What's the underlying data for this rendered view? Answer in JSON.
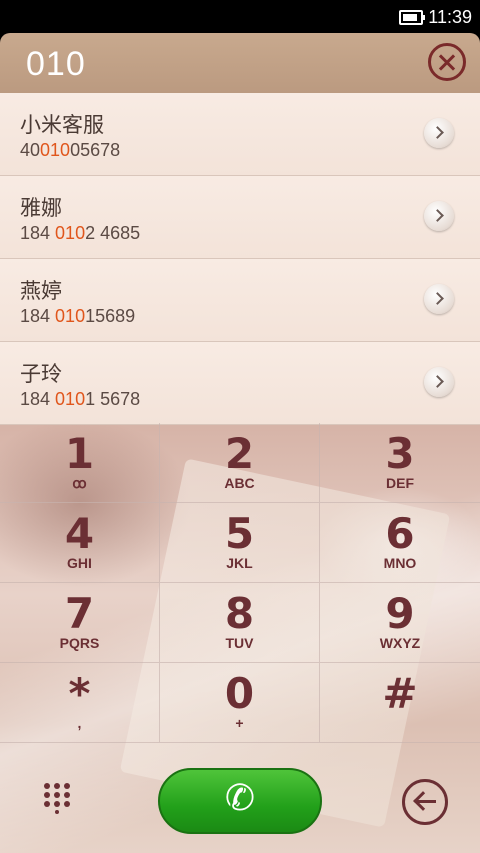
{
  "status_bar": {
    "time": "11:39"
  },
  "dialer": {
    "input": "010"
  },
  "results": [
    {
      "name": "小米客服",
      "number_pre": "40",
      "number_match": "010",
      "number_post": "05678"
    },
    {
      "name": "雅娜",
      "number_pre": "184 ",
      "number_match": "010",
      "number_post": "2 4685"
    },
    {
      "name": "燕婷",
      "number_pre": "184 ",
      "number_match": "010",
      "number_post": "15689"
    },
    {
      "name": "子玲",
      "number_pre": "184 ",
      "number_match": "010",
      "number_post": "1 5678"
    }
  ],
  "keypad": [
    {
      "digit": "1",
      "letters": "ꝏ"
    },
    {
      "digit": "2",
      "letters": "ABC"
    },
    {
      "digit": "3",
      "letters": "DEF"
    },
    {
      "digit": "4",
      "letters": "GHI"
    },
    {
      "digit": "5",
      "letters": "JKL"
    },
    {
      "digit": "6",
      "letters": "MNO"
    },
    {
      "digit": "7",
      "letters": "PQRS"
    },
    {
      "digit": "8",
      "letters": "TUV"
    },
    {
      "digit": "9",
      "letters": "WXYZ"
    },
    {
      "digit": "*",
      "letters": ","
    },
    {
      "digit": "0",
      "letters": "+"
    },
    {
      "digit": "#",
      "letters": ""
    }
  ],
  "icons": {
    "clear": "close-circle-icon",
    "chevron": "chevron-right-icon",
    "dialpad": "dialpad-grid-icon",
    "call": "phone-icon",
    "back": "back-arrow-circle-icon"
  },
  "colors": {
    "highlight": "#e0561c",
    "call_green": "#22a01a",
    "key_text": "#6b2f34"
  }
}
